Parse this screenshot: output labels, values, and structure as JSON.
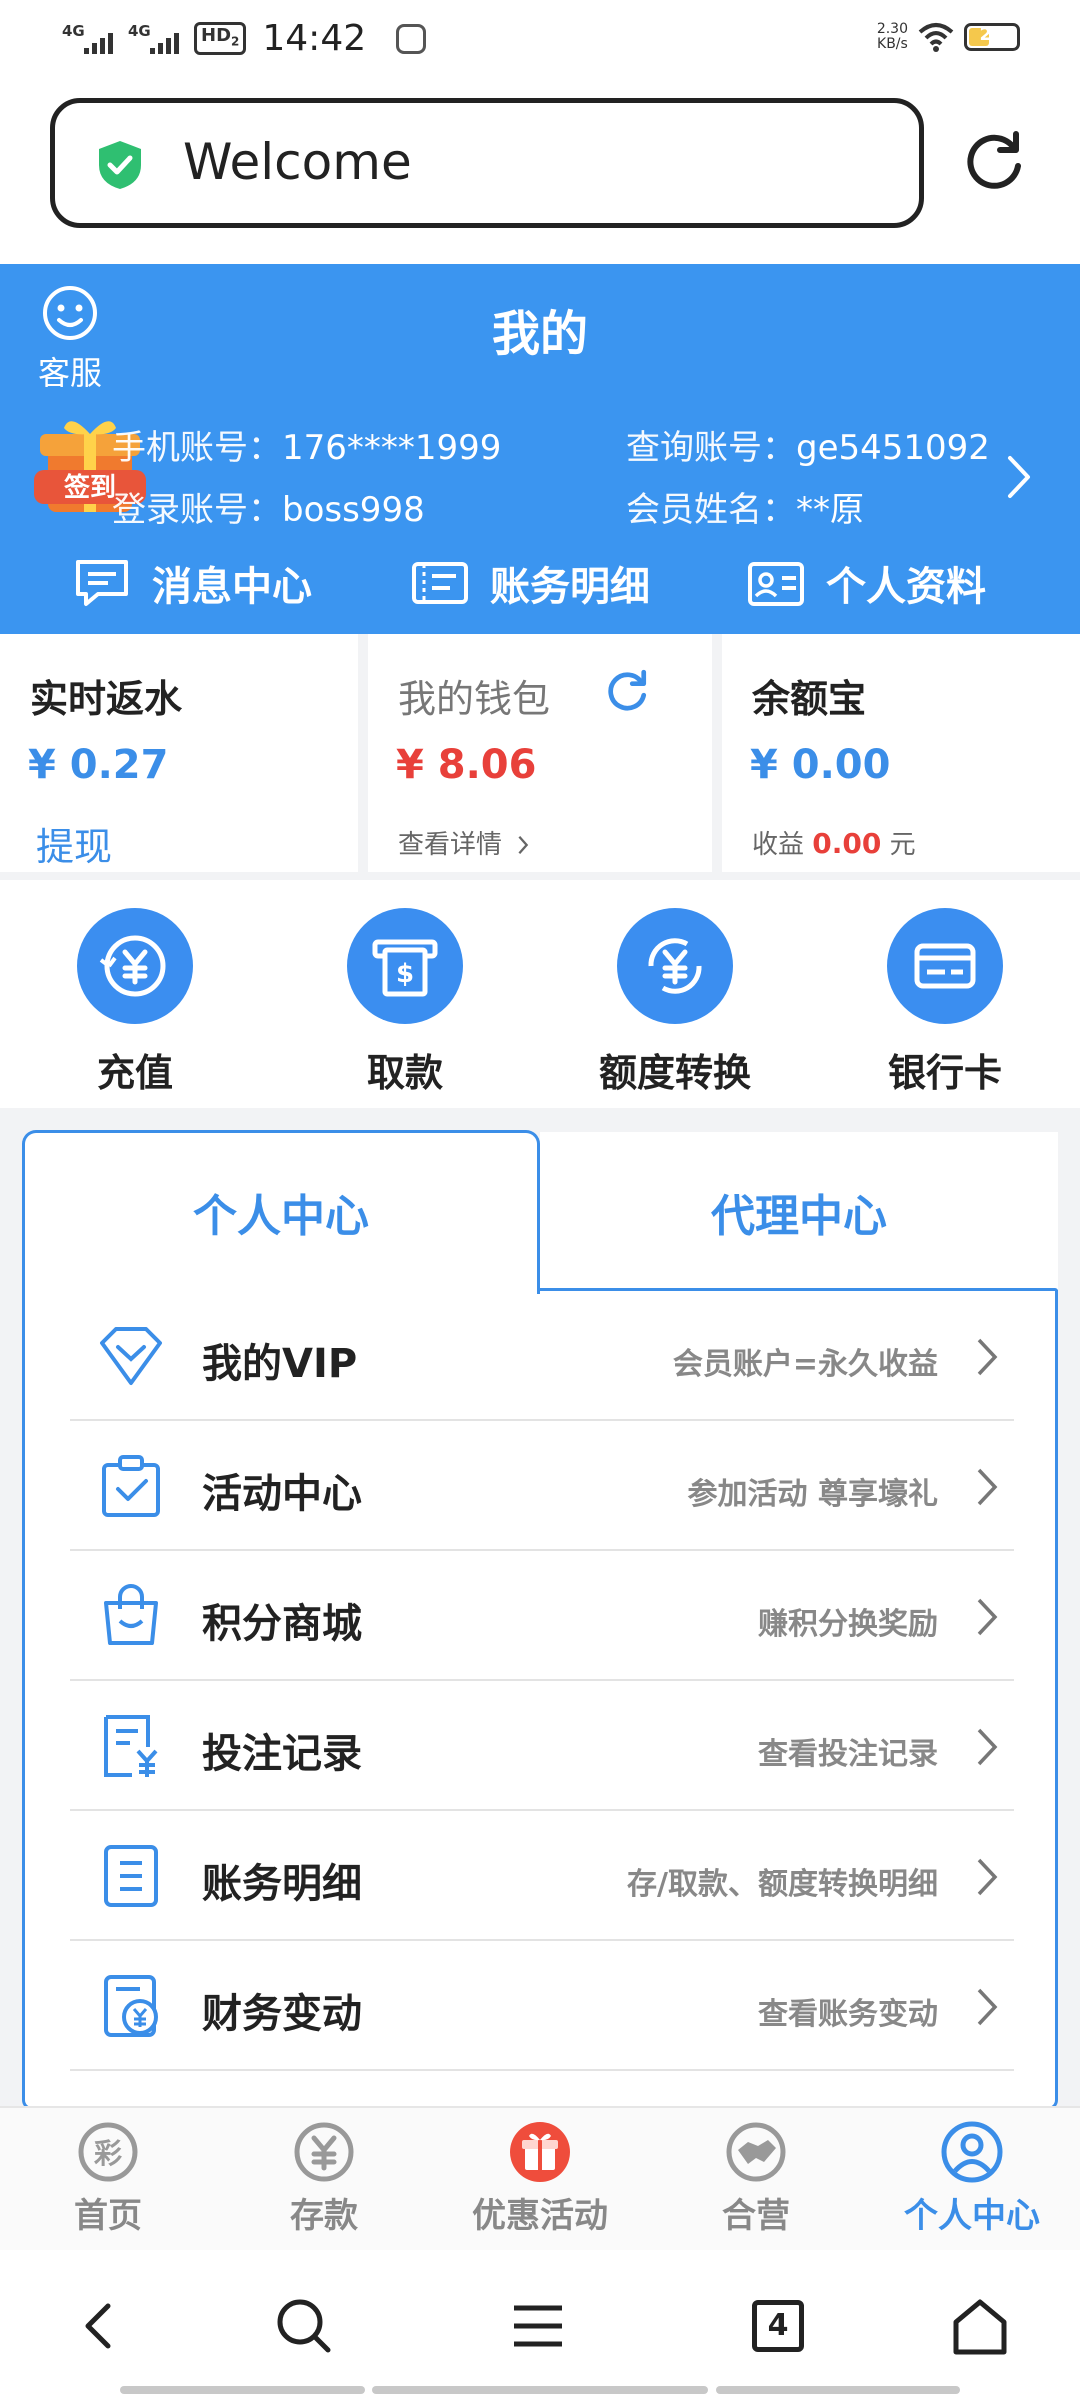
{
  "status_bar": {
    "signal1": "4G",
    "signal2": "4G",
    "hd": "HD",
    "hd_sub": "2",
    "time": "14:42",
    "speed_value": "2.30",
    "speed_unit": "KB/s",
    "battery": "20"
  },
  "browser": {
    "url_text": "Welcome"
  },
  "header": {
    "customer_service": "客服",
    "title": "我的",
    "sign_in_badge": "签到",
    "phone_label": "手机账号：",
    "phone_value": "176****1999",
    "query_label": "查询账号：",
    "query_value": "ge5451092",
    "login_label": "登录账号：",
    "login_value": "boss998",
    "member_label": "会员姓名：",
    "member_value": "**原",
    "nav": [
      "消息中心",
      "账务明细",
      "个人资料"
    ]
  },
  "wallet": {
    "rebate": {
      "title": "实时返水",
      "amount": "¥ 0.27",
      "action": "提现"
    },
    "mywallet": {
      "title": "我的钱包",
      "amount": "¥ 8.06",
      "details": "查看详情"
    },
    "yuebao": {
      "title": "余额宝",
      "amount": "¥ 0.00",
      "income_label": "收益",
      "income_value": "0.00",
      "income_unit": "元"
    }
  },
  "actions": [
    "充值",
    "取款",
    "额度转换",
    "银行卡"
  ],
  "tabs": {
    "personal": "个人中心",
    "agent": "代理中心"
  },
  "menu": [
    {
      "name": "我的VIP",
      "desc": "会员账户=永久收益",
      "icon": "diamond-icon"
    },
    {
      "name": "活动中心",
      "desc": "参加活动 尊享壕礼",
      "icon": "clipboard-check-icon"
    },
    {
      "name": "积分商城",
      "desc": "赚积分换奖励",
      "icon": "shopping-bag-icon"
    },
    {
      "name": "投注记录",
      "desc": "查看投注记录",
      "icon": "bet-record-icon"
    },
    {
      "name": "账务明细",
      "desc": "存/取款、额度转换明细",
      "icon": "document-list-icon"
    },
    {
      "name": "财务变动",
      "desc": "查看账务变动",
      "icon": "finance-change-icon"
    }
  ],
  "bottom_nav": [
    {
      "label": "首页",
      "icon": "lottery-icon",
      "active": false
    },
    {
      "label": "存款",
      "icon": "yuan-coin-icon",
      "active": false
    },
    {
      "label": "优惠活动",
      "icon": "gift-box-icon",
      "active": false
    },
    {
      "label": "合营",
      "icon": "handshake-icon",
      "active": false
    },
    {
      "label": "个人中心",
      "icon": "user-circle-icon",
      "active": true
    }
  ],
  "browser_toolbar": {
    "tab_count": "4"
  },
  "colors": {
    "primary_blue": "#3b95f0",
    "accent_red": "#e8403a",
    "muted_text": "#888888"
  }
}
